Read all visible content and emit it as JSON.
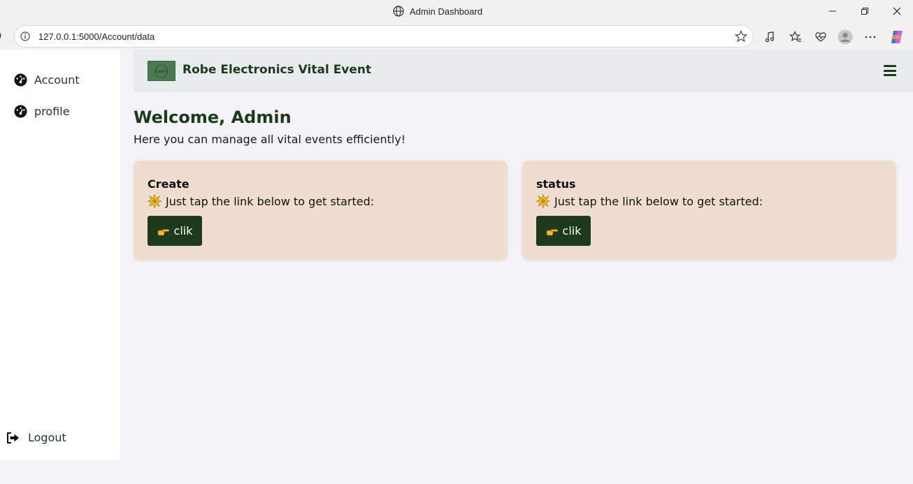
{
  "browser": {
    "title": "Admin Dashboard",
    "url": "127.0.0.1:5000/Account/data"
  },
  "sidebar": {
    "items": [
      {
        "label": "Account",
        "icon": "dashboard-gauge-icon"
      },
      {
        "label": "profile",
        "icon": "dashboard-gauge-icon"
      }
    ],
    "logout_label": "Logout"
  },
  "header": {
    "brand": "Robe Electronics Vital Event",
    "logo_text": "EVENTS"
  },
  "main": {
    "welcome": "Welcome, Admin",
    "subtitle": "Here you can manage all vital events efficiently!",
    "cards": [
      {
        "title": "Create",
        "text": "Just tap the link below to get started:",
        "button_label": "clik"
      },
      {
        "title": "status",
        "text": "Just tap the link below to get started:",
        "button_label": "clik"
      }
    ]
  },
  "colors": {
    "accent": "#1e3a1d",
    "card_bg": "#efdecf",
    "header_bg": "#e9ecec",
    "page_bg": "#f3f2f7"
  }
}
